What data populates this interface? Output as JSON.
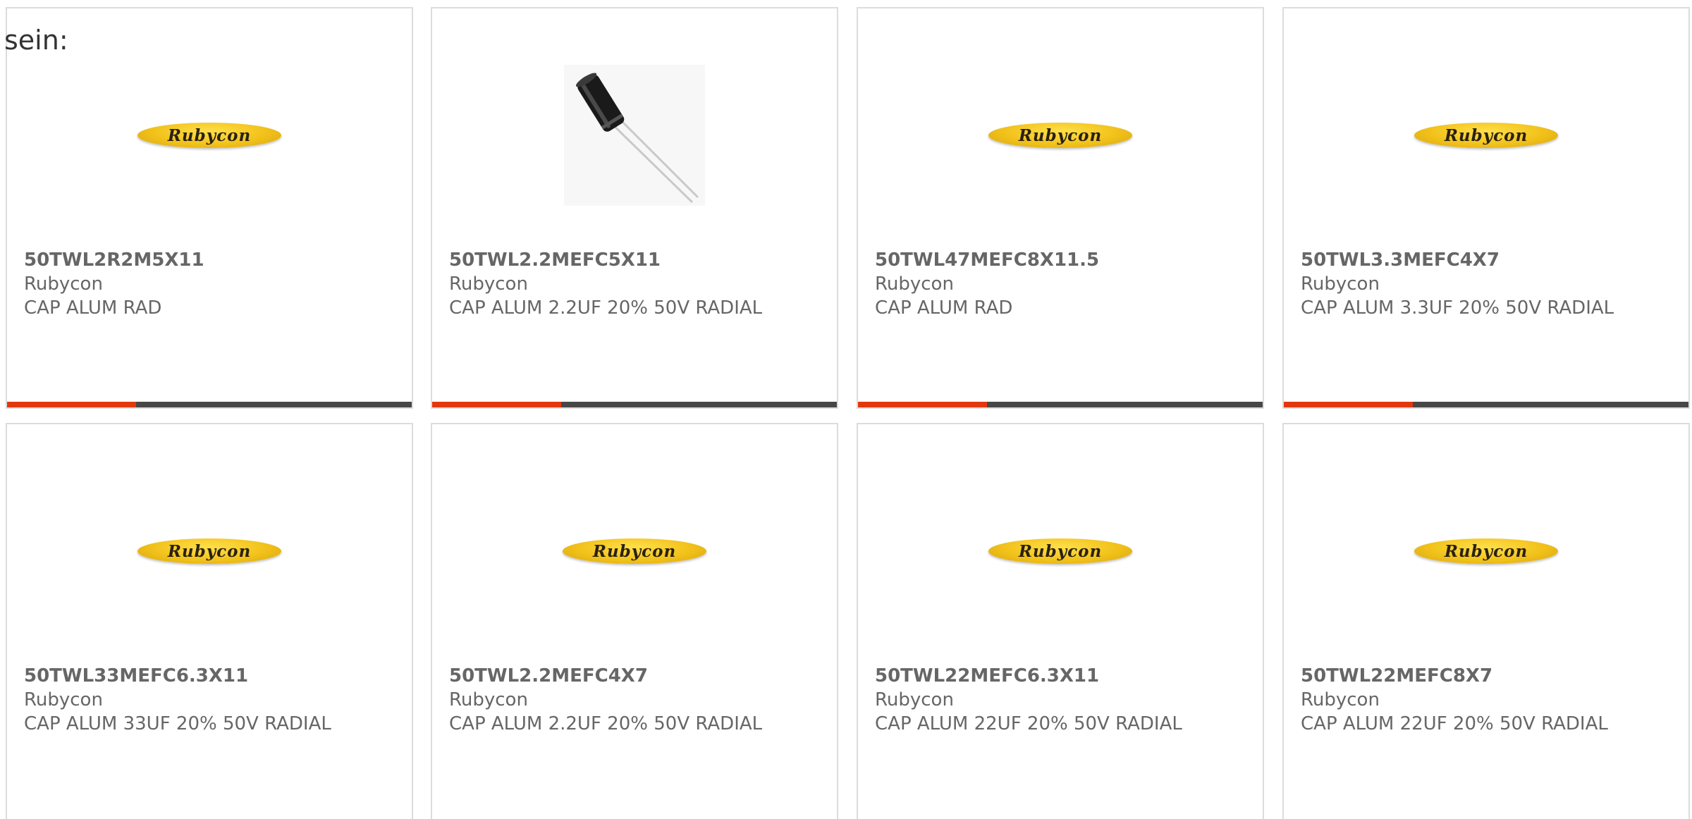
{
  "lead_text": "sein:",
  "logo_text": "Rubycon",
  "accent_color": "#e2380d",
  "bar_color": "#474747",
  "logo_color": "#f2c21b",
  "cards": [
    {
      "part_number": "50TWL2R2M5X11",
      "manufacturer": "Rubycon",
      "description": "CAP ALUM RAD",
      "image": "rubycon-logo"
    },
    {
      "part_number": "50TWL2.2MEFC5X11",
      "manufacturer": "Rubycon",
      "description": "CAP ALUM 2.2UF 20% 50V RADIAL",
      "image": "capacitor-photo"
    },
    {
      "part_number": "50TWL47MEFC8X11.5",
      "manufacturer": "Rubycon",
      "description": "CAP ALUM RAD",
      "image": "rubycon-logo"
    },
    {
      "part_number": "50TWL3.3MEFC4X7",
      "manufacturer": "Rubycon",
      "description": "CAP ALUM 3.3UF 20% 50V RADIAL",
      "image": "rubycon-logo"
    },
    {
      "part_number": "50TWL33MEFC6.3X11",
      "manufacturer": "Rubycon",
      "description": "CAP ALUM 33UF 20% 50V RADIAL",
      "image": "rubycon-logo"
    },
    {
      "part_number": "50TWL2.2MEFC4X7",
      "manufacturer": "Rubycon",
      "description": "CAP ALUM 2.2UF 20% 50V RADIAL",
      "image": "rubycon-logo"
    },
    {
      "part_number": "50TWL22MEFC6.3X11",
      "manufacturer": "Rubycon",
      "description": "CAP ALUM 22UF 20% 50V RADIAL",
      "image": "rubycon-logo"
    },
    {
      "part_number": "50TWL22MEFC8X7",
      "manufacturer": "Rubycon",
      "description": "CAP ALUM 22UF 20% 50V RADIAL",
      "image": "rubycon-logo"
    }
  ]
}
